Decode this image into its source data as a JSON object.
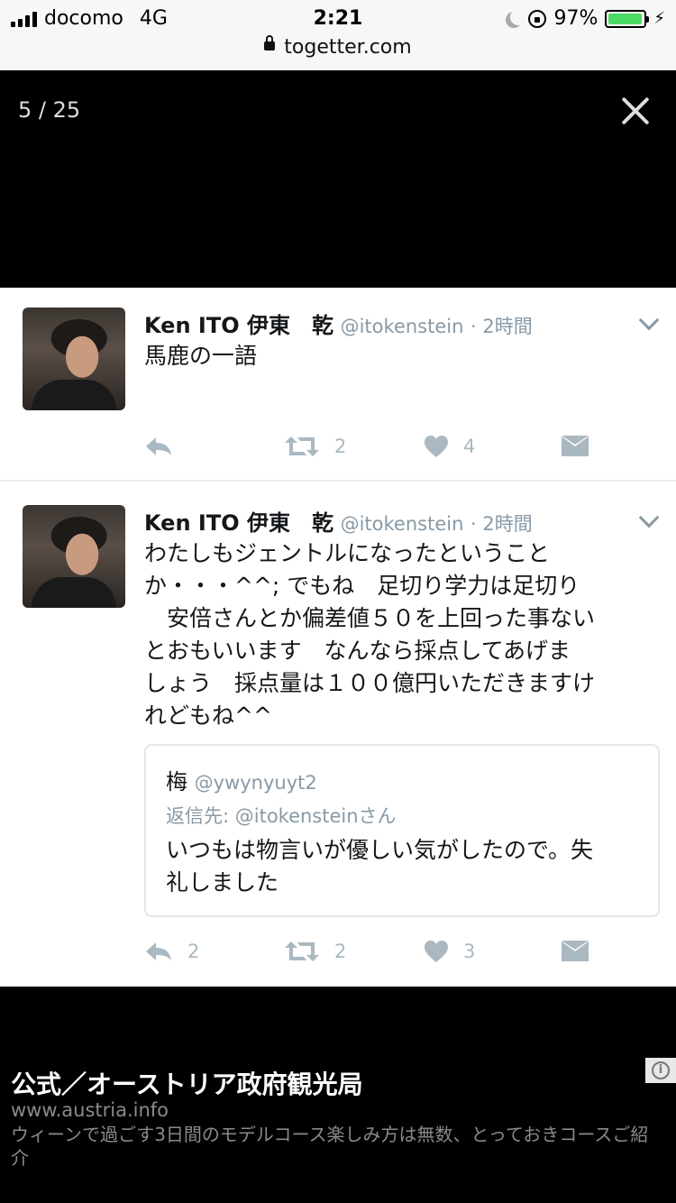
{
  "status_bar": {
    "carrier": "docomo",
    "network": "4G",
    "time": "2:21",
    "battery": "97%",
    "battery_level": 0.97
  },
  "url_bar": {
    "domain": "togetter.com"
  },
  "viewer": {
    "counter": "5 / 25",
    "close_icon": "close-icon"
  },
  "tweets": [
    {
      "name": "Ken ITO 伊東　乾",
      "handle": "@itokenstein",
      "time": "· 2時間",
      "text": "馬鹿の一語",
      "reply_count": "",
      "retweet_count": "2",
      "like_count": "4"
    },
    {
      "name": "Ken ITO 伊東　乾",
      "handle": "@itokenstein",
      "time": "· 2時間",
      "text_lines": [
        "わたしもジェントルになったということ",
        "か・・・^^; でもね　足切り学力は足切り",
        "　安倍さんとか偏差値５０を上回った事ない",
        "とおもいいます　なんなら採点してあげま",
        "しょう　採点量は１００億円いただきますけ",
        "れどもね^^"
      ],
      "quote": {
        "name": "梅",
        "handle": "@ywynyuyt2",
        "reply_to": "返信先: @itokensteinさん",
        "text_lines": [
          "いつもは物言いが優しい気がしたので。失",
          "礼しました"
        ]
      },
      "reply_count": "2",
      "retweet_count": "2",
      "like_count": "3"
    }
  ],
  "ad": {
    "title": "公式／オーストリア政府観光局",
    "url": "www.austria.info",
    "description": "ウィーンで過ごす3日間のモデルコース楽しみ方は無数、とっておきコースご紹介",
    "info_glyph": "i"
  }
}
